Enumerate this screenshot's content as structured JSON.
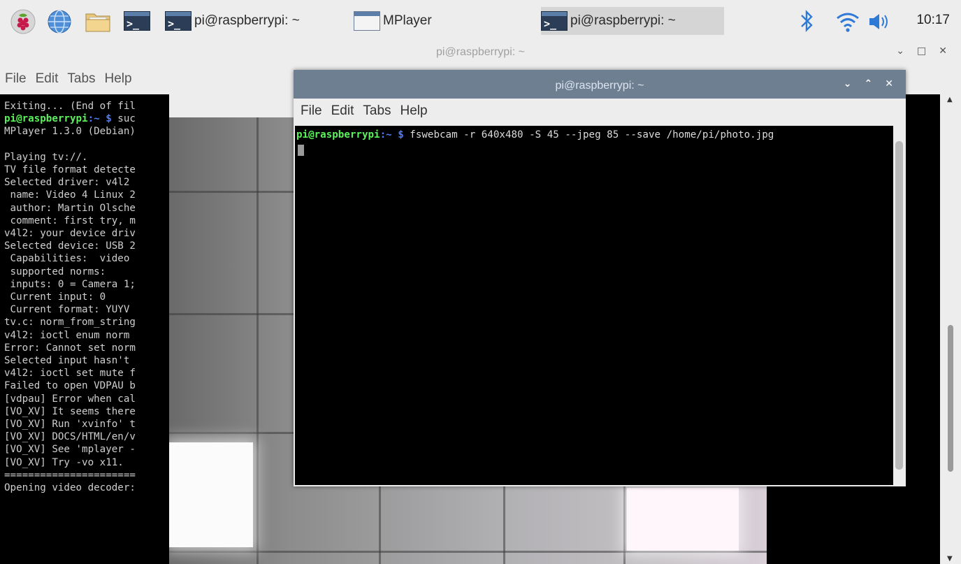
{
  "taskbar": {
    "tasks": [
      {
        "label": "pi@raspberrypi: ~"
      },
      {
        "label": "MPlayer"
      },
      {
        "label": "pi@raspberrypi: ~"
      }
    ],
    "clock": "10:17",
    "icons": [
      "raspberry-menu-icon",
      "web-browser-icon",
      "file-manager-icon",
      "terminal-launcher-icon",
      "bluetooth-icon",
      "wifi-icon",
      "volume-icon"
    ]
  },
  "back_terminal": {
    "title": "pi@raspberrypi: ~",
    "menu": [
      "File",
      "Edit",
      "Tabs",
      "Help"
    ],
    "first_line": "Exiting... (End of fil",
    "prompt_user": "pi@raspberrypi",
    "prompt_path": ":~ $",
    "prompt_cmd": " suc",
    "lines": [
      "MPlayer 1.3.0 (Debian)",
      "",
      "Playing tv://.",
      "TV file format detecte",
      "Selected driver: v4l2",
      " name: Video 4 Linux 2",
      " author: Martin Olsche",
      " comment: first try, m",
      "v4l2: your device driv",
      "Selected device: USB 2",
      " Capabilities:  video",
      " supported norms:",
      " inputs: 0 = Camera 1;",
      " Current input: 0",
      " Current format: YUYV",
      "tv.c: norm_from_string",
      "v4l2: ioctl enum norm",
      "Error: Cannot set norm",
      "Selected input hasn't",
      "v4l2: ioctl set mute f",
      "Failed to open VDPAU b",
      "[vdpau] Error when cal",
      "[VO_XV] It seems there",
      "[VO_XV] Run 'xvinfo' t",
      "[VO_XV] DOCS/HTML/en/v",
      "[VO_XV] See 'mplayer -",
      "[VO_XV] Try -vo x11.",
      "======================",
      "Opening video decoder:"
    ]
  },
  "front_terminal": {
    "title": "pi@raspberrypi: ~",
    "menu": [
      "File",
      "Edit",
      "Tabs",
      "Help"
    ],
    "prompt_user": "pi@raspberrypi",
    "prompt_path": ":~ $",
    "command": " fswebcam -r 640x480 -S 45 --jpeg 85 --save /home/pi/photo.jpg"
  },
  "colors": {
    "prompt_user": "#5cf25c",
    "prompt_path": "#4d7dff",
    "active_title": "#6f7f92"
  }
}
